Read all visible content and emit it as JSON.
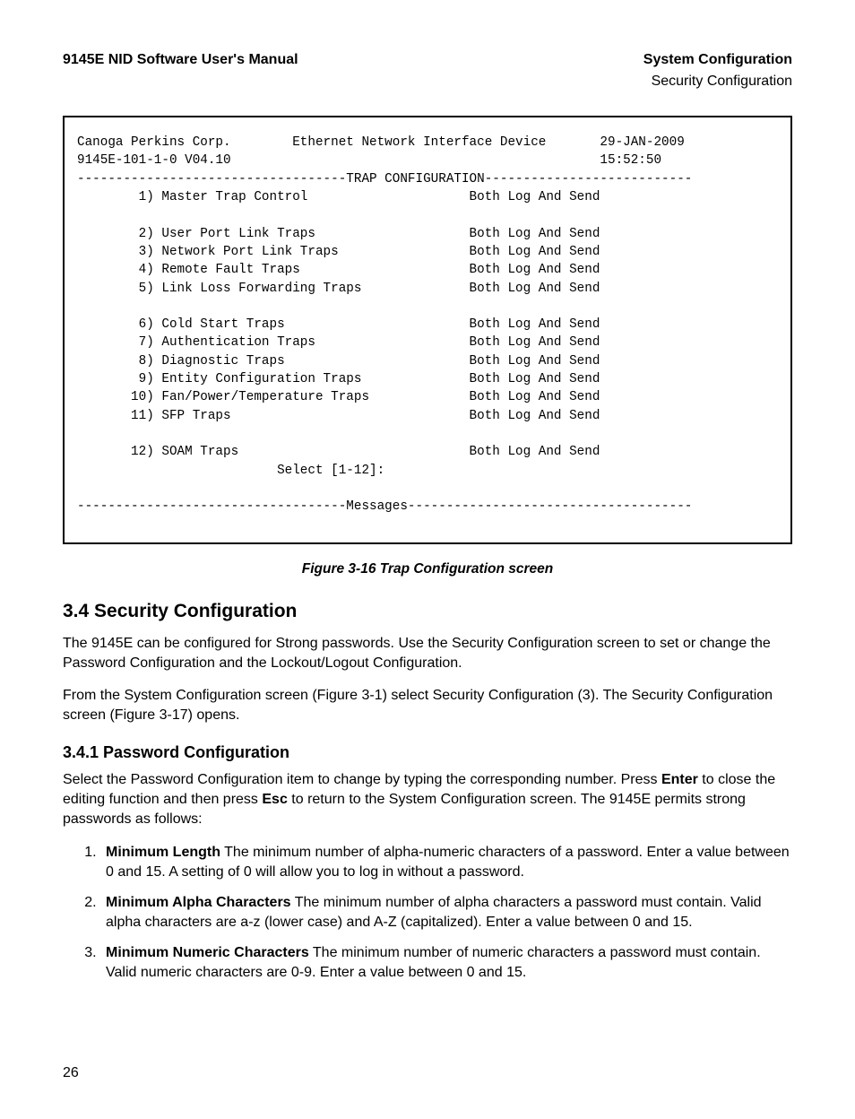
{
  "header": {
    "left": "9145E NID Software User's Manual",
    "right": "System Configuration",
    "sub_right": "Security Configuration"
  },
  "terminal": {
    "line1_left": "Canoga Perkins Corp.",
    "line1_center": "Ethernet Network Interface Device",
    "line1_right": "29-JAN-2009",
    "line2_left": "9145E-101-1-0 V04.10",
    "line2_right": "15:52:50",
    "section_title": "TRAP CONFIGURATION",
    "items": [
      {
        "num": "1)",
        "label": "Master Trap Control",
        "value": "Both Log And Send"
      },
      {
        "num": "2)",
        "label": "User Port Link Traps",
        "value": "Both Log And Send"
      },
      {
        "num": "3)",
        "label": "Network Port Link Traps",
        "value": "Both Log And Send"
      },
      {
        "num": "4)",
        "label": "Remote Fault Traps",
        "value": "Both Log And Send"
      },
      {
        "num": "5)",
        "label": "Link Loss Forwarding Traps",
        "value": "Both Log And Send"
      },
      {
        "num": "6)",
        "label": "Cold Start Traps",
        "value": "Both Log And Send"
      },
      {
        "num": "7)",
        "label": "Authentication Traps",
        "value": "Both Log And Send"
      },
      {
        "num": "8)",
        "label": "Diagnostic Traps",
        "value": "Both Log And Send"
      },
      {
        "num": "9)",
        "label": "Entity Configuration Traps",
        "value": "Both Log And Send"
      },
      {
        "num": "10)",
        "label": "Fan/Power/Temperature Traps",
        "value": "Both Log And Send"
      },
      {
        "num": "11)",
        "label": "SFP Traps",
        "value": "Both Log And Send"
      },
      {
        "num": "12)",
        "label": "SOAM Traps",
        "value": "Both Log And Send"
      }
    ],
    "prompt": "Select [1-12]:",
    "footer_title": "Messages"
  },
  "figure_caption": "Figure 3-16  Trap Configuration screen",
  "section_heading": "3.4  Security Configuration",
  "para1": "The 9145E can be configured for Strong passwords. Use the Security Configuration screen to set or change the Password Configuration and the Lockout/Logout Configuration.",
  "para2": "From the System Configuration screen (Figure 3-1) select Security Configuration (3). The Security Configuration screen (Figure 3-17) opens.",
  "subsection_heading": "3.4.1  Password Configuration",
  "para3_pre": "Select the Password Configuration item to change by typing the corresponding number. Press ",
  "para3_b1": "Enter",
  "para3_mid": " to close the editing function and then press ",
  "para3_b2": "Esc",
  "para3_post": " to return to the System Configuration screen. The 9145E permits strong passwords as follows:",
  "list": [
    {
      "bold": "Minimum Length",
      "rest": "  The minimum number of alpha-numeric characters of a password. Enter a value between 0 and 15. A setting of 0 will allow you to log in without a password."
    },
    {
      "bold": "Minimum Alpha Characters",
      "rest": " The minimum number of alpha characters a password must contain. Valid alpha characters are a-z (lower case) and A-Z (capitalized). Enter a value between 0 and 15."
    },
    {
      "bold": "Minimum Numeric Characters",
      "rest": " The minimum number of numeric characters a password must contain. Valid numeric characters are 0-9. Enter a value between 0 and 15."
    }
  ],
  "page_number": "26"
}
